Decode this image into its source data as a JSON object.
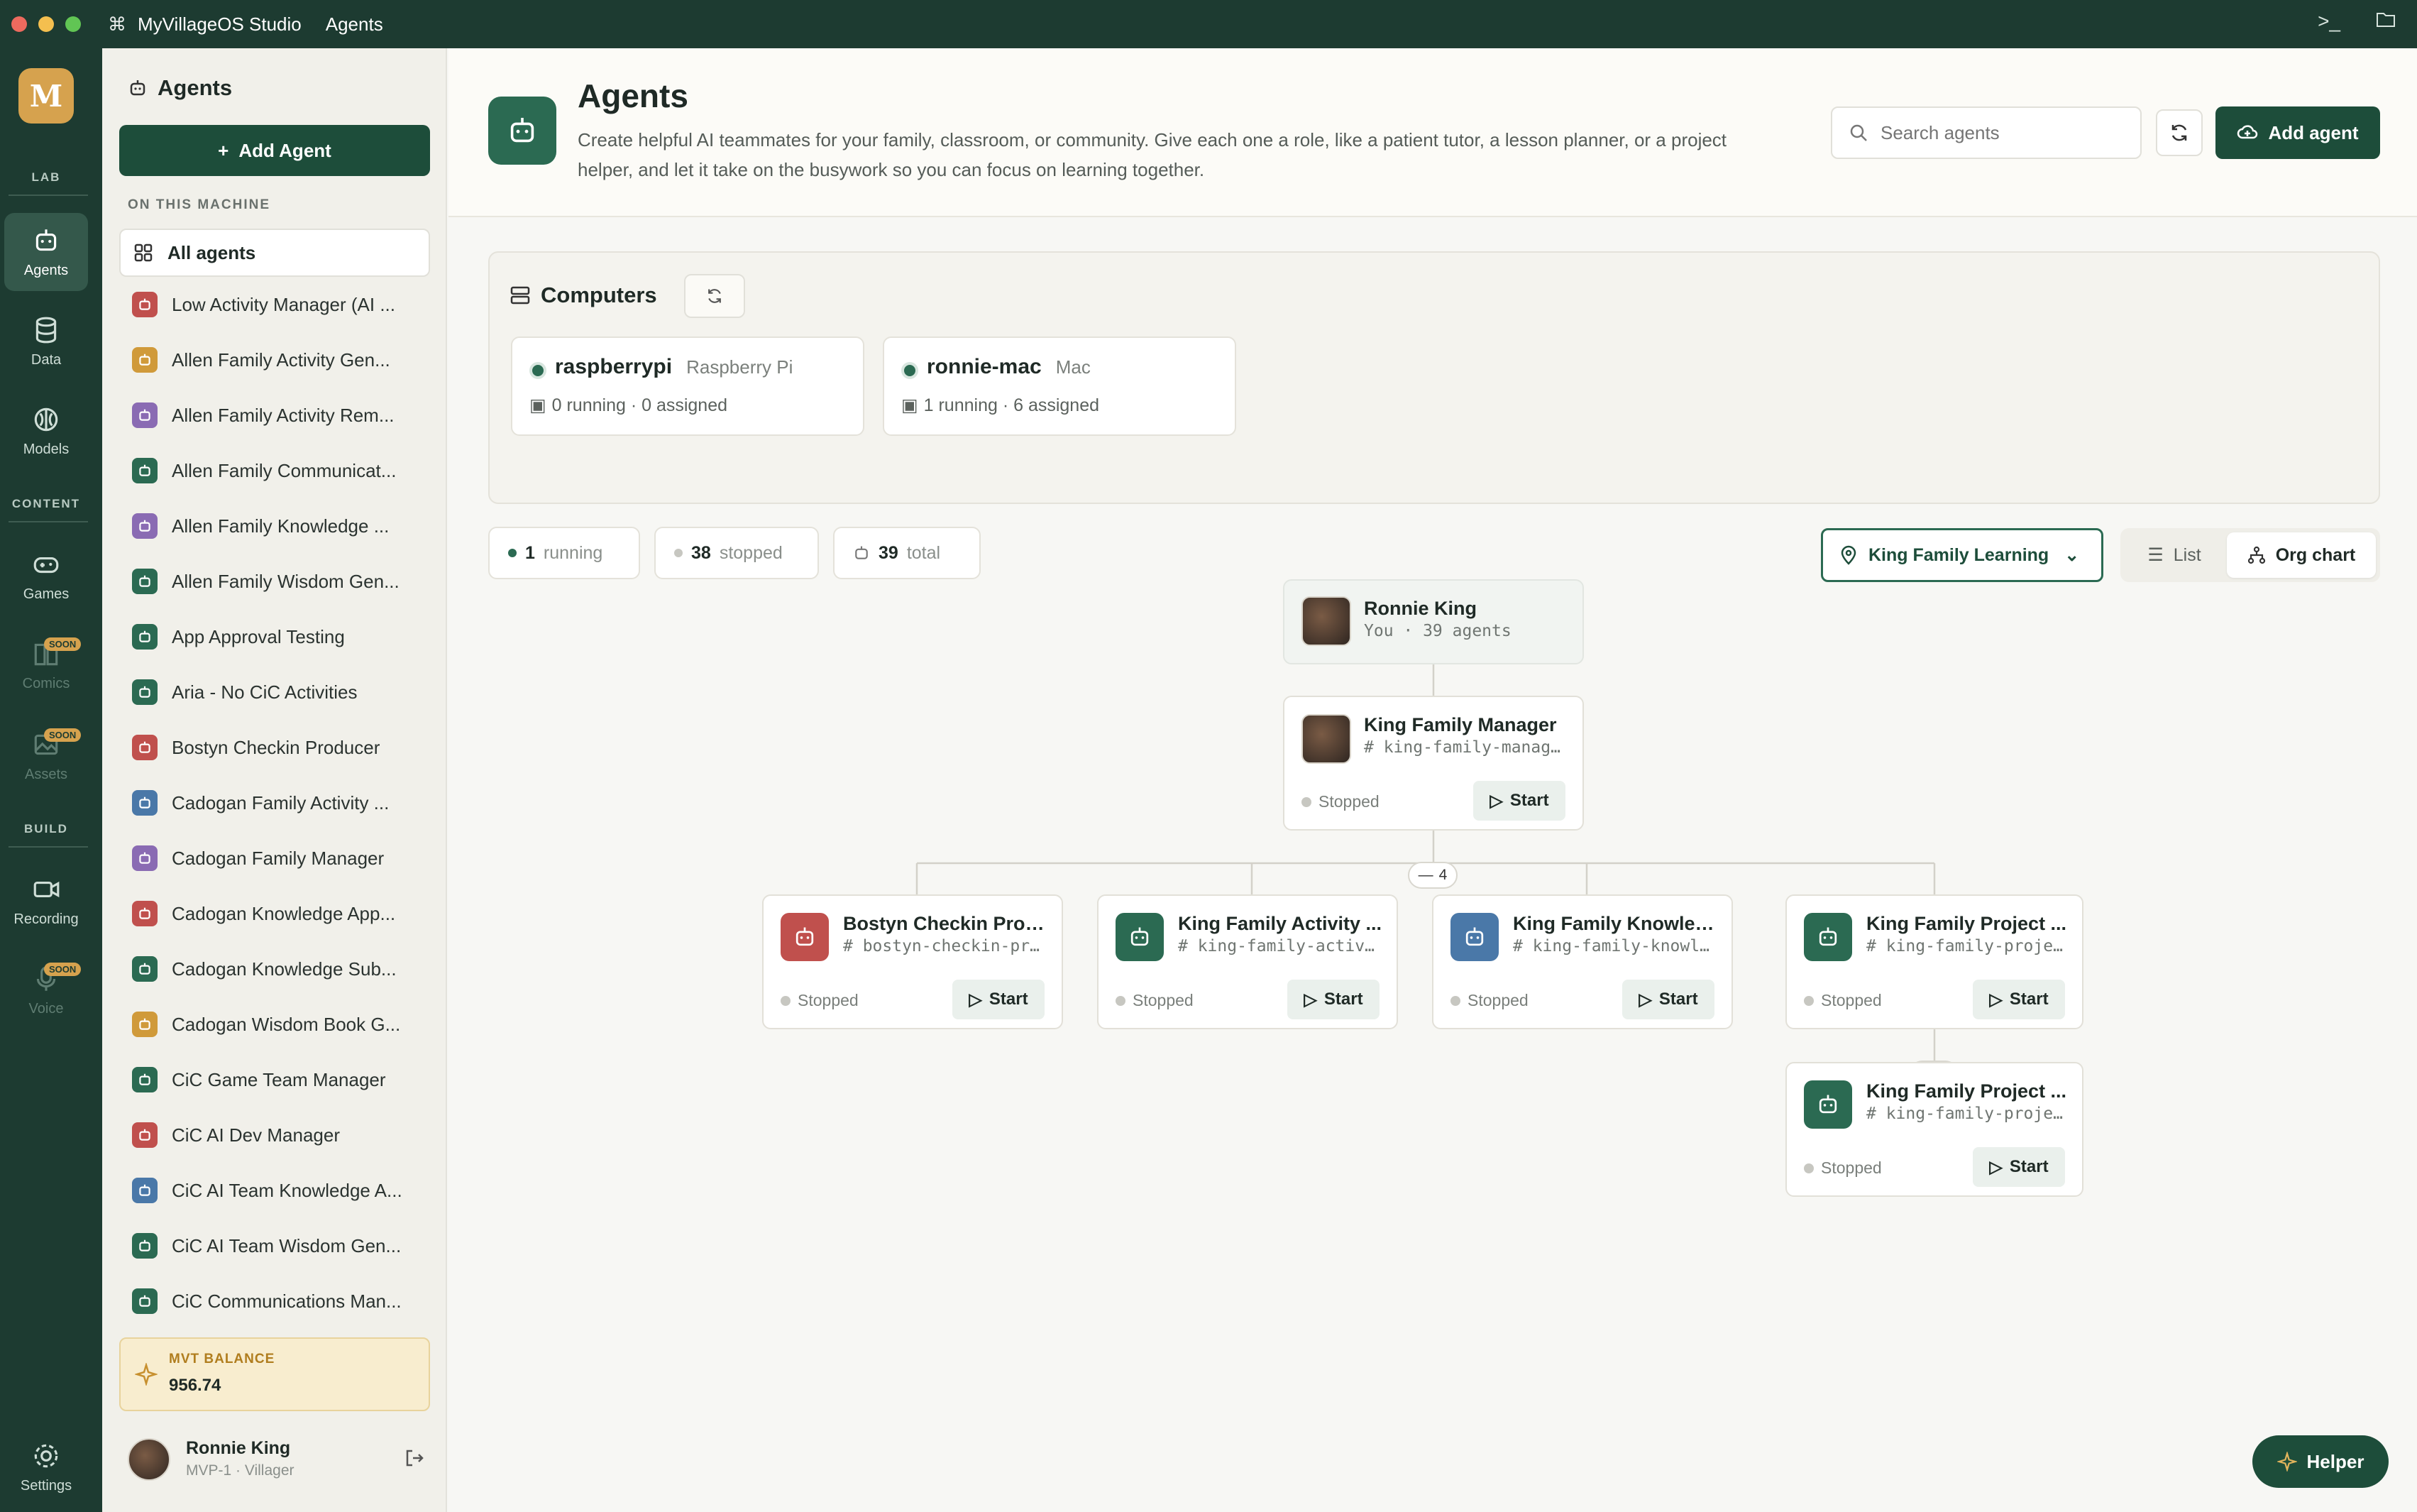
{
  "window": {
    "app_name": "MyVillageOS Studio",
    "section": "Agents"
  },
  "rail": {
    "sections": {
      "lab": "LAB",
      "content": "CONTENT",
      "build": "BUILD"
    },
    "items": {
      "agents": "Agents",
      "data": "Data",
      "models": "Models",
      "games": "Games",
      "comics": "Comics",
      "assets": "Assets",
      "recording": "Recording",
      "voice": "Voice",
      "settings": "Settings"
    },
    "soon_badge": "SOON"
  },
  "sidebar": {
    "title": "Agents",
    "add_label": "Add Agent",
    "machine_label": "ON THIS MACHINE",
    "all_agents": "All agents",
    "agents": [
      {
        "name": "Low Activity Manager (AI ...",
        "color": "#c0504d"
      },
      {
        "name": "Allen Family Activity Gen...",
        "color": "#d09a3a"
      },
      {
        "name": "Allen Family Activity Rem...",
        "color": "#8a6bb3"
      },
      {
        "name": "Allen Family Communicat...",
        "color": "#2b6a52"
      },
      {
        "name": "Allen Family Knowledge ...",
        "color": "#8a6bb3"
      },
      {
        "name": "Allen Family Wisdom Gen...",
        "color": "#2b6a52"
      },
      {
        "name": "App Approval Testing",
        "color": "#2b6a52"
      },
      {
        "name": "Aria - No CiC Activities",
        "color": "#2b6a52"
      },
      {
        "name": "Bostyn Checkin Producer",
        "color": "#c0504d"
      },
      {
        "name": "Cadogan Family Activity ...",
        "color": "#4a78a8"
      },
      {
        "name": "Cadogan Family Manager",
        "color": "#8a6bb3"
      },
      {
        "name": "Cadogan Knowledge App...",
        "color": "#c0504d"
      },
      {
        "name": "Cadogan Knowledge Sub...",
        "color": "#2b6a52"
      },
      {
        "name": "Cadogan Wisdom Book G...",
        "color": "#d09a3a"
      },
      {
        "name": "CiC Game Team Manager",
        "color": "#2b6a52"
      },
      {
        "name": "CiC AI Dev Manager",
        "color": "#c0504d"
      },
      {
        "name": "CiC AI Team Knowledge A...",
        "color": "#4a78a8"
      },
      {
        "name": "CiC AI Team Wisdom Gen...",
        "color": "#2b6a52"
      },
      {
        "name": "CiC Communications Man...",
        "color": "#2b6a52"
      }
    ],
    "balance_label": "MVT BALANCE",
    "balance_value": "956.74",
    "user_name": "Ronnie King",
    "user_sub": "MVP-1 · Villager"
  },
  "header": {
    "title": "Agents",
    "description": "Create helpful AI teammates for your family, classroom, or community. Give each one a role, like a patient tutor, a lesson planner, or a project helper, and let it take on the busywork so you can focus on learning together.",
    "search_placeholder": "Search agents",
    "add_label": "Add agent"
  },
  "computers": {
    "title": "Computers",
    "items": [
      {
        "name": "raspberrypi",
        "kind": "Raspberry Pi",
        "stats": "0 running · 0 assigned"
      },
      {
        "name": "ronnie-mac",
        "kind": "Mac",
        "stats": "1 running · 6 assigned"
      }
    ]
  },
  "stats": {
    "running_count": "1",
    "running_label": "running",
    "stopped_count": "38",
    "stopped_label": "stopped",
    "total_count": "39",
    "total_label": "total"
  },
  "filters": {
    "location": "King Family Learning",
    "view_list": "List",
    "view_org": "Org chart"
  },
  "org": {
    "root": {
      "name": "Ronnie King",
      "sub": "You · 39 agents"
    },
    "manager": {
      "name": "King Family Manager",
      "slug": "# king-family-manager",
      "status": "Stopped",
      "start": "Start",
      "children_count": "4"
    },
    "children": [
      {
        "name": "Bostyn Checkin Prod...",
        "slug": "# bostyn-checkin-pro...",
        "status": "Stopped",
        "start": "Start",
        "color": "#c0504d"
      },
      {
        "name": "King Family Activity ...",
        "slug": "# king-family-activi...",
        "status": "Stopped",
        "start": "Start",
        "color": "#2b6a52"
      },
      {
        "name": "King Family Knowled...",
        "slug": "# king-family-knowle...",
        "status": "Stopped",
        "start": "Start",
        "color": "#4a78a8"
      },
      {
        "name": "King Family Project ...",
        "slug": "# king-family-projec...",
        "status": "Stopped",
        "start": "Start",
        "color": "#2b6a52",
        "children_count": "1"
      }
    ],
    "grandchild": {
      "name": "King Family Project ...",
      "slug": "# king-family-projec...",
      "status": "Stopped",
      "start": "Start",
      "color": "#2b6a52"
    }
  },
  "helper_label": "Helper"
}
